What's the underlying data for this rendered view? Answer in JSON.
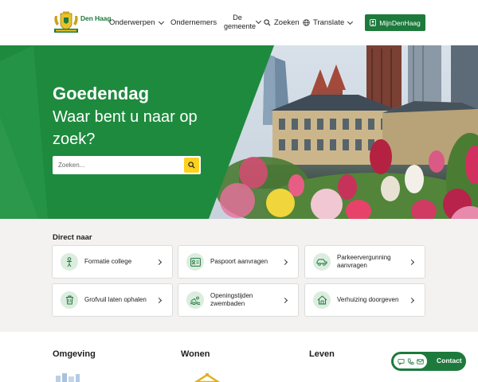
{
  "header": {
    "logo_text": "Den Haag",
    "nav": [
      {
        "label": "Onderwerpen"
      },
      {
        "label": "Ondernemers"
      },
      {
        "label": "De gemeente"
      },
      {
        "label": "Zoeken"
      },
      {
        "label": "Translate"
      }
    ],
    "mijn_button": "MijnDenHaag"
  },
  "hero": {
    "title": "Goedendag",
    "subtitle": "Waar bent u naar op zoek?",
    "search_placeholder": "Zoeken..."
  },
  "direct": {
    "title": "Direct naar",
    "tiles": [
      {
        "label": "Formatie college",
        "icon": "person-icon"
      },
      {
        "label": "Paspoort aanvragen",
        "icon": "id-card-icon"
      },
      {
        "label": "Parkeervergunning aanvragen",
        "icon": "car-icon"
      },
      {
        "label": "Grofvuil laten ophalen",
        "icon": "trash-icon"
      },
      {
        "label": "Openingstijden zwembaden",
        "icon": "swim-icon"
      },
      {
        "label": "Verhuizing doorgeven",
        "icon": "house-icon"
      }
    ]
  },
  "categories": [
    "Omgeving",
    "Wonen",
    "Leven"
  ],
  "contact": {
    "label": "Contact"
  },
  "colors": {
    "brand_green": "#1d7a3c",
    "hero_green": "#1e8a3e",
    "search_yellow": "#ffd21f",
    "section_grey": "#f3f2f1"
  }
}
